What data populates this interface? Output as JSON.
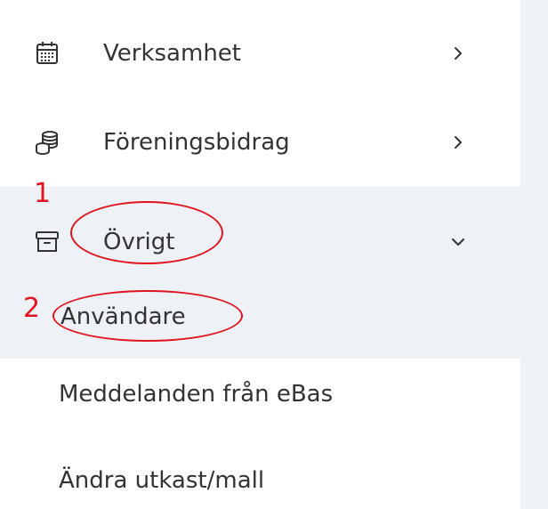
{
  "sidebar": {
    "items": [
      {
        "label": "Verksamhet",
        "icon": "calendar-icon",
        "chevron": "chevron-right-icon"
      },
      {
        "label": "Föreningsbidrag",
        "icon": "coins-icon",
        "chevron": "chevron-right-icon"
      },
      {
        "label": "Övrigt",
        "icon": "box-icon",
        "chevron": "chevron-down-icon",
        "expanded": true,
        "children": [
          {
            "label": "Användare"
          }
        ]
      }
    ],
    "extra_items": [
      {
        "label": "Meddelanden från eBas"
      },
      {
        "label": "Ändra utkast/mall"
      }
    ]
  },
  "annotations": {
    "marker_1": "1",
    "marker_2": "2",
    "color": "#e0141e"
  },
  "colors": {
    "text": "#333333",
    "active_bg": "#eef1f5",
    "panel_bg": "#eef1f5"
  }
}
